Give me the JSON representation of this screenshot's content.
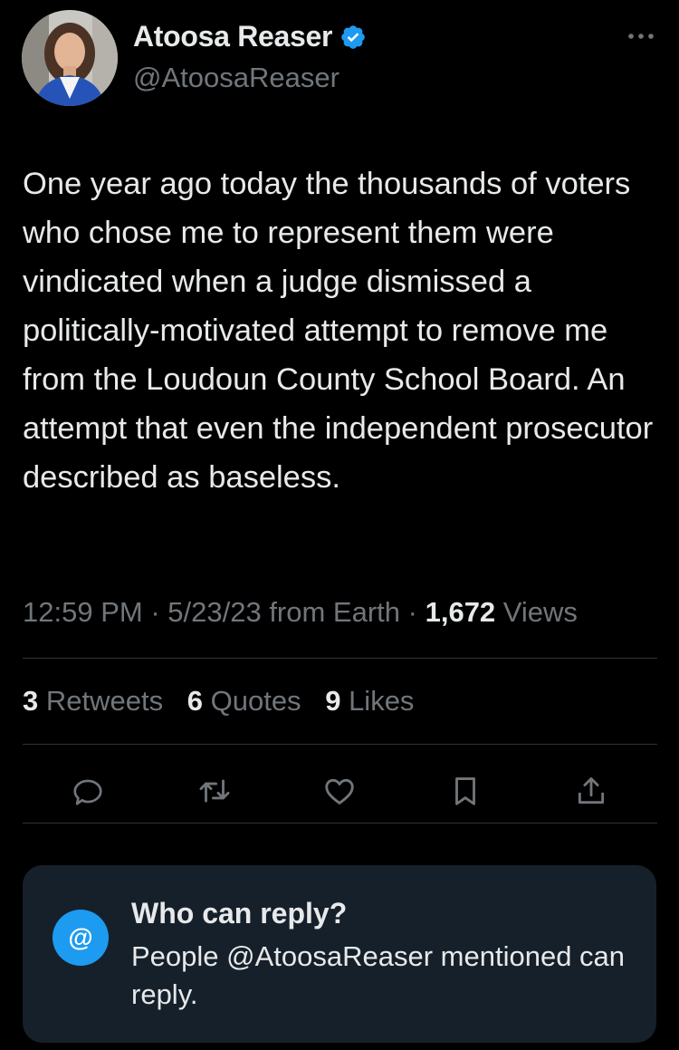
{
  "author": {
    "display_name": "Atoosa Reaser",
    "handle": "@AtoosaReaser",
    "verified_icon": "verified-badge-icon",
    "avatar_icon": "avatar"
  },
  "tweet": {
    "text": "One year ago today the thousands of voters who chose me to represent them were vindicated when a judge dismissed a politically-motivated attempt to remove me from the Loudoun County School Board. An attempt that even the independent prosecutor described as baseless."
  },
  "meta": {
    "time": "12:59 PM",
    "sep1": " · ",
    "date": "5/23/23",
    "source": " from Earth",
    "sep2": " · ",
    "views_count": "1,672",
    "views_label": " Views"
  },
  "stats": {
    "retweets_count": "3",
    "retweets_label": "Retweets",
    "quotes_count": "6",
    "quotes_label": "Quotes",
    "likes_count": "9",
    "likes_label": "Likes"
  },
  "actions": [
    "reply-icon",
    "retweet-icon",
    "like-icon",
    "bookmark-icon",
    "share-icon"
  ],
  "reply_settings": {
    "icon_text": "@",
    "title": "Who can reply?",
    "description": "People @AtoosaReaser mentioned can reply."
  },
  "colors": {
    "background": "#000000",
    "text": "#e7e9ea",
    "secondary": "#71767b",
    "accent": "#1d9bf0",
    "card": "#16202b",
    "divider": "#2f3336"
  }
}
